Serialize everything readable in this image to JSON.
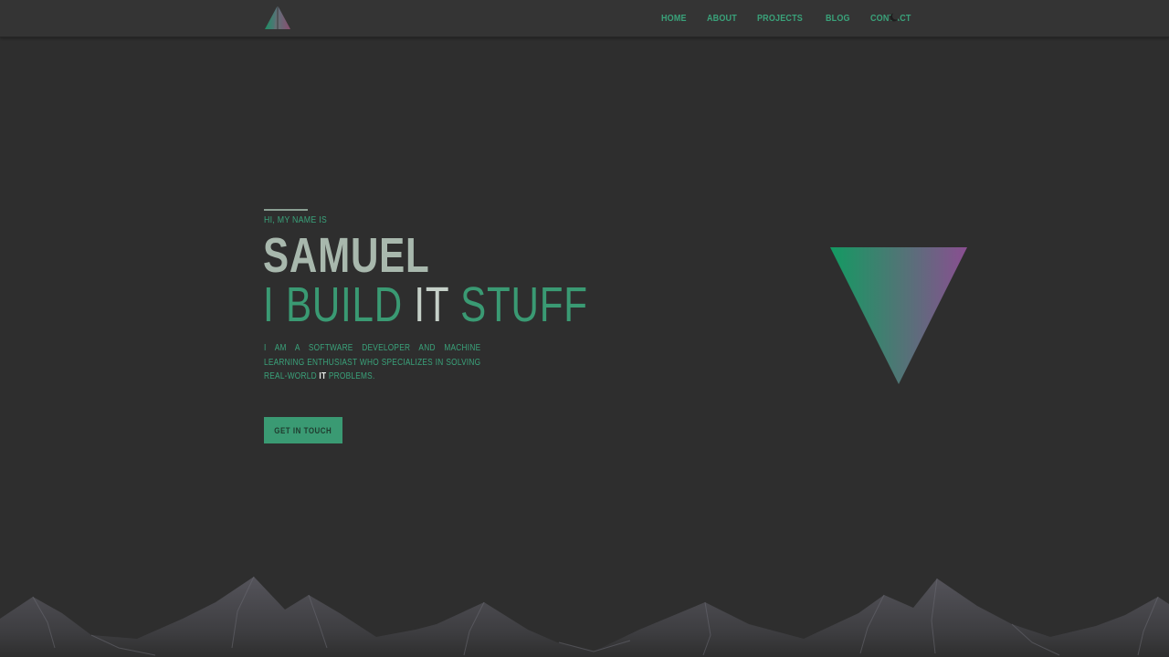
{
  "nav": {
    "logo_icon": "triangle-logo-icon",
    "links": [
      "HOME",
      "ABOUT",
      "PROJECTS",
      "BLOG",
      "CONTACT"
    ],
    "theme_toggle_icon": "moon-icon"
  },
  "hero": {
    "intro": "HI, MY NAME IS",
    "name": "SAMUEL",
    "tagline_part1": "I BUILD ",
    "tagline_highlight": "IT",
    "tagline_part2": " STUFF",
    "description_part1": "I am a software developer and machine learning enthusiast who specializes in solving real-world ",
    "description_highlight": "IT",
    "description_part2": " problems.",
    "cta_label": "GET IN TOUCH"
  },
  "colors": {
    "background": "#2e2e2e",
    "navbar": "#343434",
    "accent": "#3a9a73",
    "triangle_gradient_start": "#139a62",
    "triangle_gradient_end": "#8a4e91",
    "mountains": "#4a4a4f"
  }
}
